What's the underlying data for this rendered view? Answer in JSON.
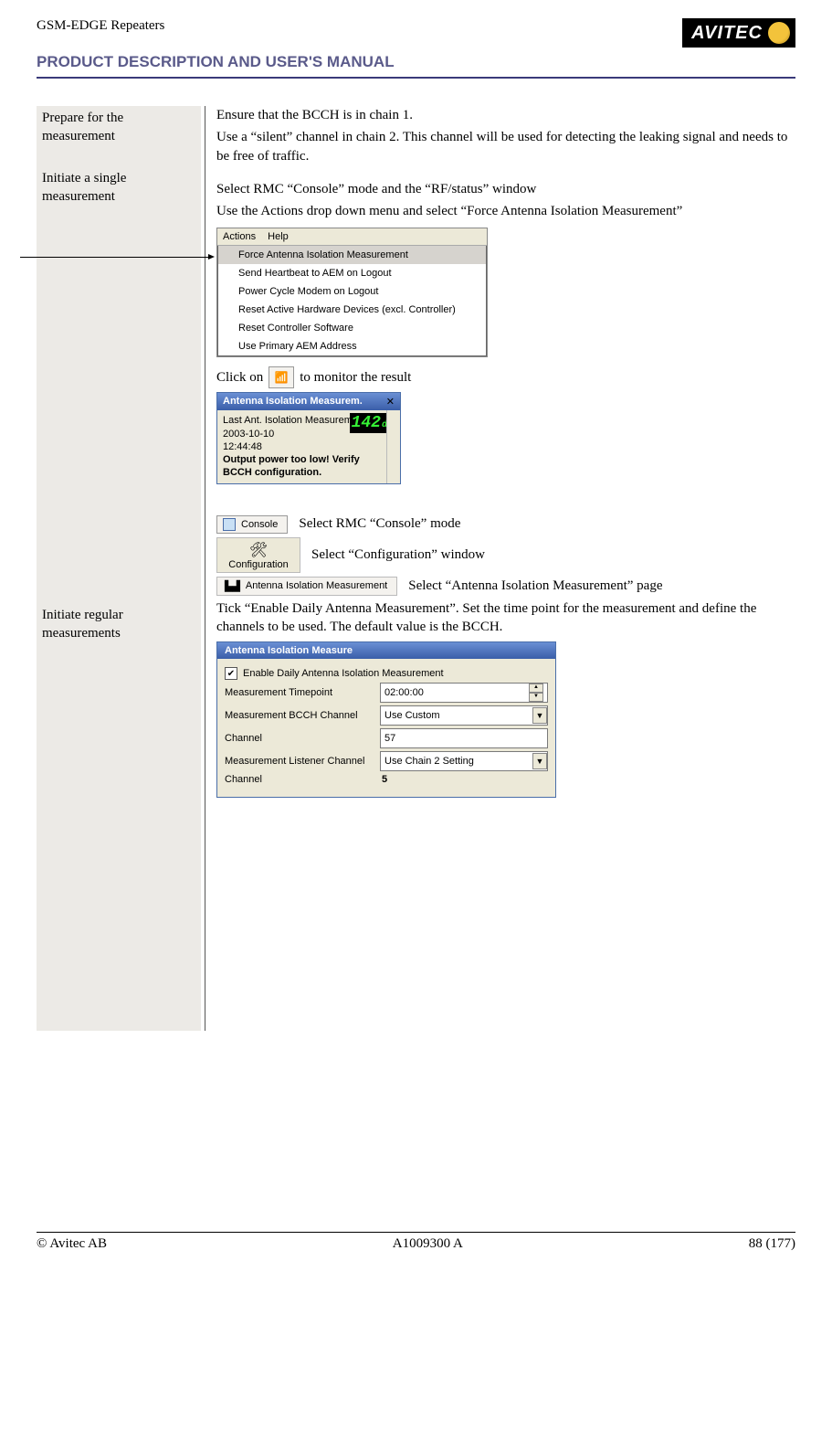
{
  "header": {
    "title": "GSM-EDGE Repeaters",
    "logo_text": "AVITEC",
    "product_line": "PRODUCT DESCRIPTION AND USER'S MANUAL"
  },
  "sidebar": {
    "prepare": "Prepare for the measurement",
    "single": "Initiate a single measurement",
    "regular": "Initiate regular measurements"
  },
  "prepare": {
    "p1": "Ensure that the BCCH is in chain 1.",
    "p2": "Use a “silent” channel in chain 2. This channel will be used for detecting the leaking signal and needs to be free of traffic."
  },
  "single": {
    "p1": "Select RMC “Console” mode and the “RF/status” window",
    "p2": "Use the Actions drop down menu and select “Force Antenna Isolation Measurement”",
    "menubar": {
      "actions": "Actions",
      "help": "Help"
    },
    "menu": [
      "Force Antenna Isolation Measurement",
      "Send Heartbeat to AEM on Logout",
      "Power Cycle Modem on Logout",
      "Reset Active Hardware Devices (excl. Controller)",
      "Reset Controller Software",
      "Use Primary AEM Address"
    ],
    "click_pre": "Click on",
    "click_post": "to monitor the result",
    "panel": {
      "title": "Antenna Isolation Measurem.",
      "line1": "Last Ant. Isolation Measurement",
      "line2": "2003-10-10",
      "line3": "12:44:48",
      "db": "142",
      "db_unit": "dB",
      "warn1": "Output power too low! Verify",
      "warn2": "BCCH configuration."
    }
  },
  "regular": {
    "console_label": "Console",
    "console_text": "Select RMC “Console” mode",
    "config_label": "Configuration",
    "config_text": "Select “Configuration” window",
    "aim_label": "Antenna Isolation Measurement",
    "aim_text": "Select “Antenna Isolation Measurement” page",
    "tick_text": "Tick “Enable Daily Antenna Measurement”. Set the time point for the measurement and define the channels to be used. The default value is the BCCH.",
    "form": {
      "title": "Antenna Isolation Measure",
      "enable": "Enable Daily Antenna Isolation Measurement",
      "rows": {
        "timepoint_label": "Measurement Timepoint",
        "timepoint_value": "02:00:00",
        "bcch_label": "Measurement BCCH Channel",
        "bcch_value": "Use Custom",
        "channel1_label": "Channel",
        "channel1_value": "57",
        "listener_label": "Measurement Listener Channel",
        "listener_value": "Use Chain 2 Setting",
        "channel2_label": "Channel",
        "channel2_value": "5"
      }
    }
  },
  "footer": {
    "left": "© Avitec AB",
    "center": "A1009300 A",
    "right": "88 (177)"
  }
}
